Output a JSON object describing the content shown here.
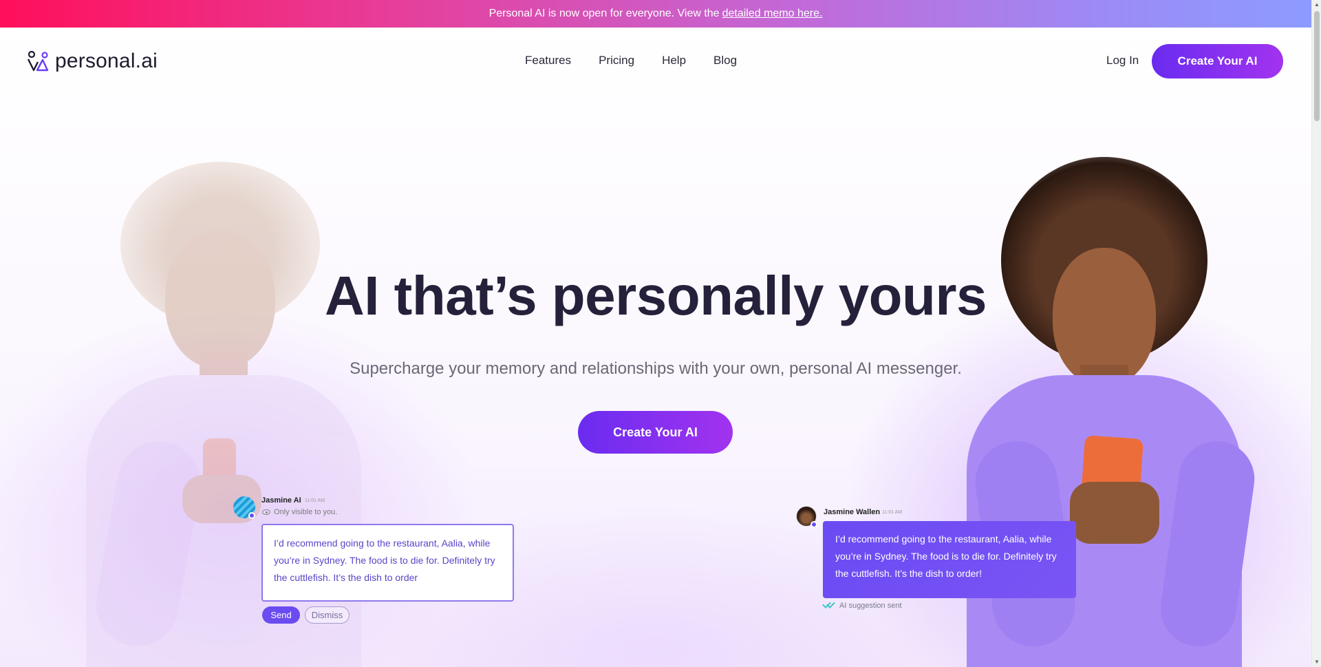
{
  "announcement": {
    "text": "Personal AI is now open for everyone. View the",
    "link_text": "detailed memo here."
  },
  "header": {
    "logo_text": "personal.ai",
    "nav": [
      "Features",
      "Pricing",
      "Help",
      "Blog"
    ],
    "login_label": "Log In",
    "cta_label": "Create Your AI"
  },
  "hero": {
    "title": "AI that’s personally yours",
    "subtitle": "Supercharge your memory and relationships with your own, personal AI messenger.",
    "cta_label": "Create Your AI"
  },
  "chat_left": {
    "name": "Jasmine AI",
    "time": "11:01 AM",
    "visibility": "Only visible to you.",
    "message": "I’d recommend going to the restaurant, Aalia, while you’re in Sydney. The food is to die for. Definitely try the cuttlefish. It’s the dish to order",
    "send_label": "Send",
    "dismiss_label": "Dismiss"
  },
  "chat_right": {
    "name": "Jasmine Wallen",
    "time": "11:01 AM",
    "message": "I’d recommend going to the restaurant, Aalia, while you’re in Sydney. The food is to die for. Definitely try the cuttlefish. It’s the dish to order!",
    "status": "AI suggestion sent"
  },
  "colors": {
    "brand_purple": "#6a2cf0",
    "brand_violet": "#a233ef",
    "bubble_purple": "#6b4af3",
    "announce_pink": "#ff0f5b"
  }
}
